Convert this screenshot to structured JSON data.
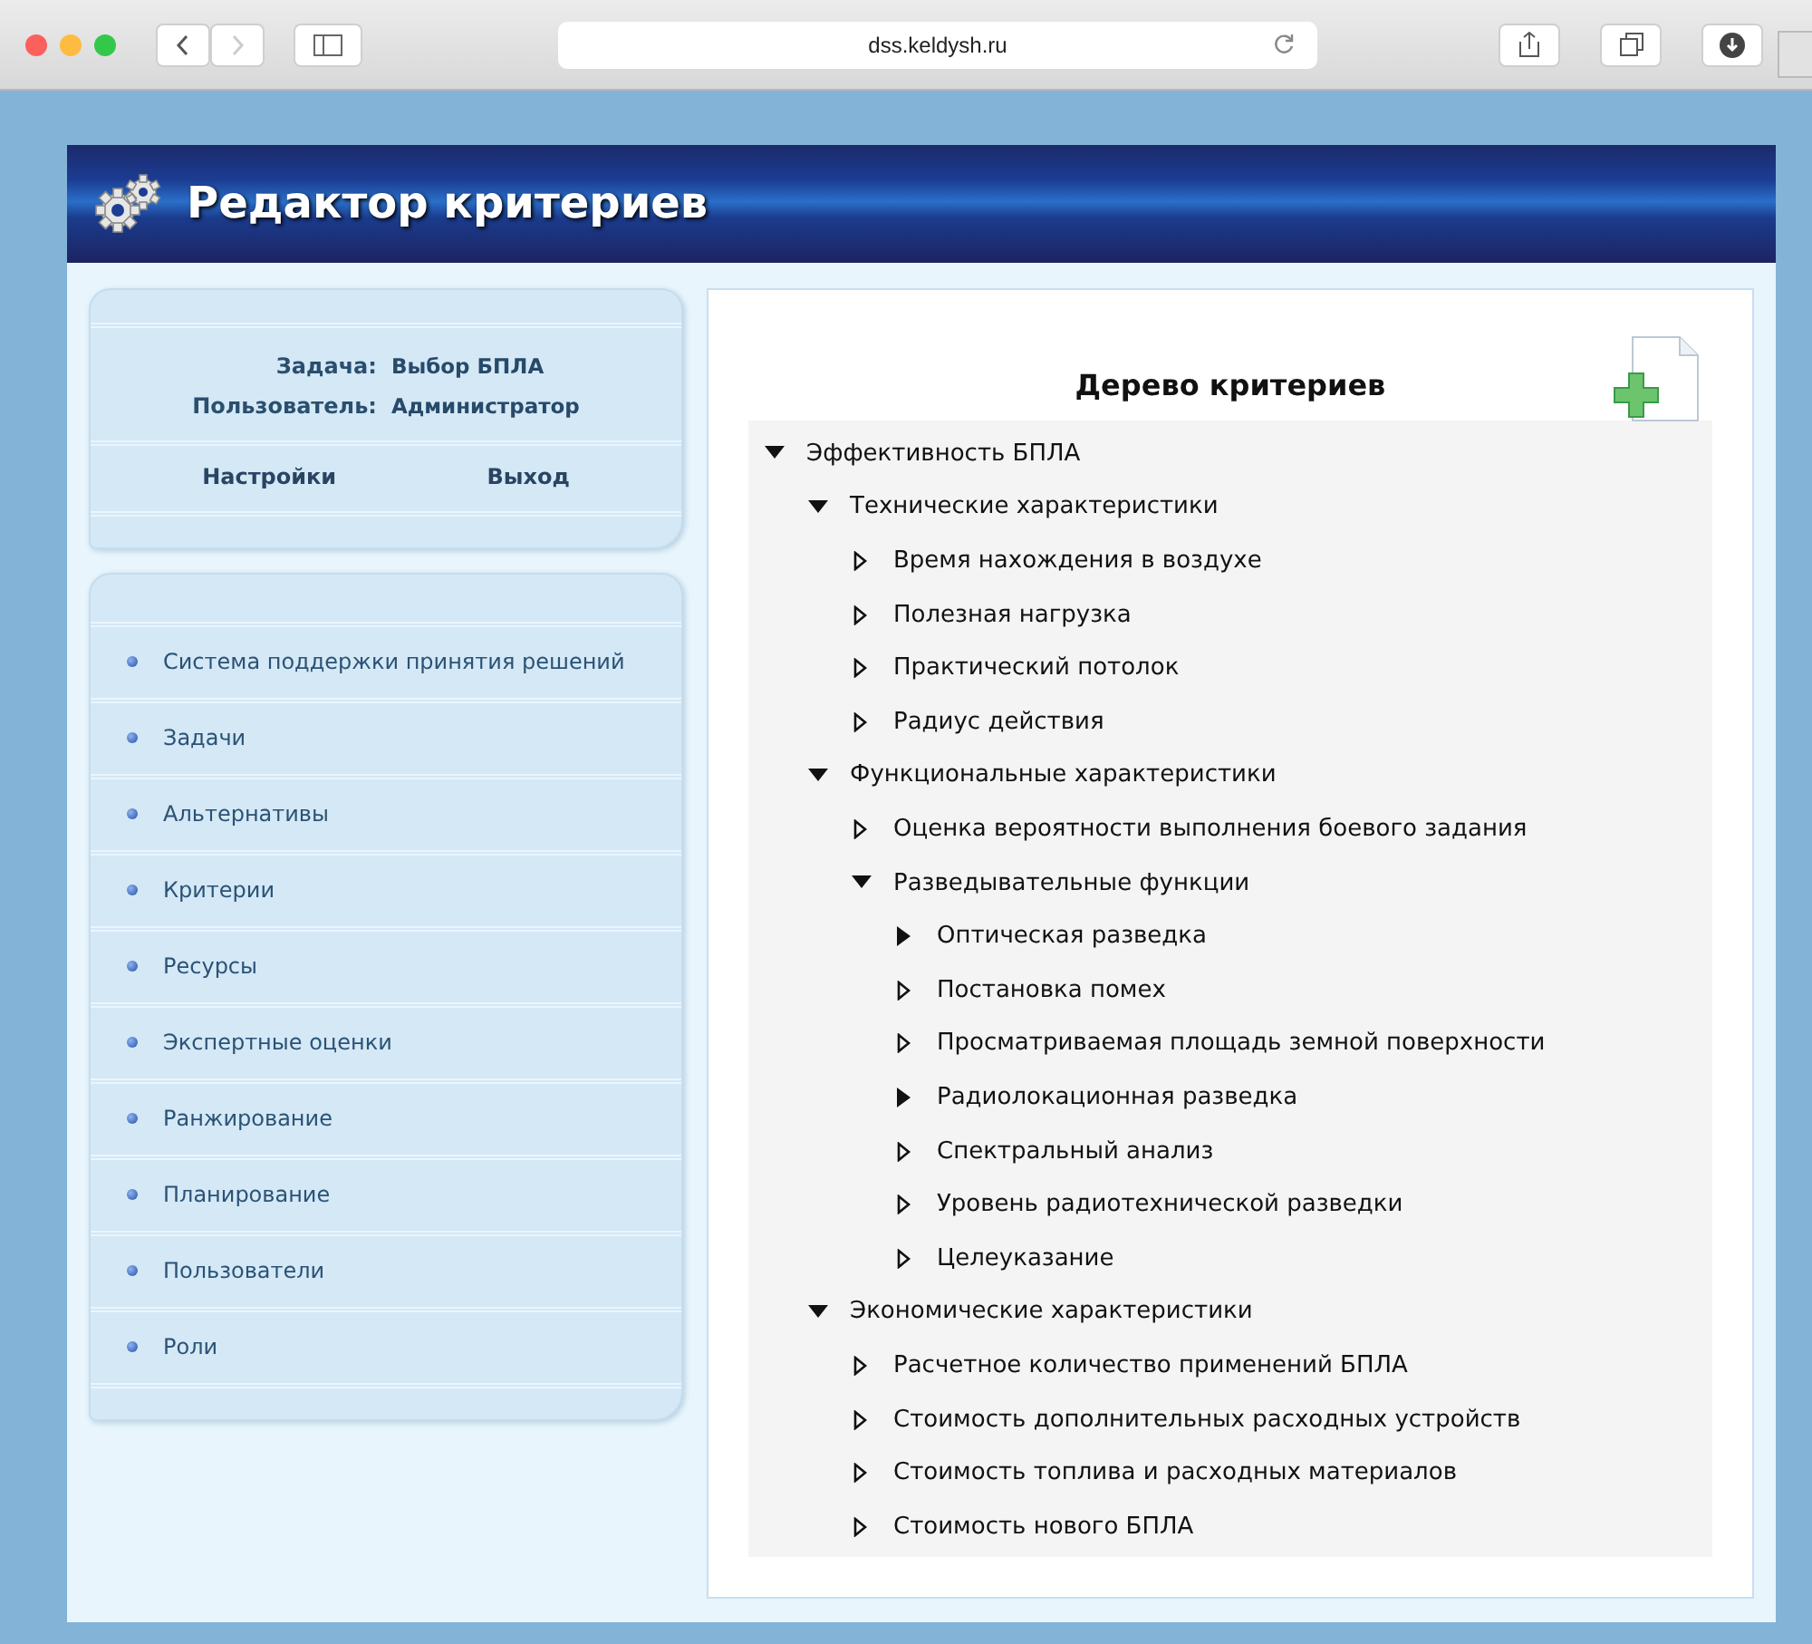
{
  "browser": {
    "address": "dss.keldysh.ru"
  },
  "header": {
    "title": "Редактор критериев"
  },
  "session": {
    "fields": [
      {
        "label": "Задача:",
        "value": "Выбор БПЛА"
      },
      {
        "label": "Пользователь:",
        "value": "Администратор"
      }
    ],
    "links": [
      "Настройки",
      "Выход"
    ]
  },
  "nav": [
    "Система поддержки принятия решений",
    "Задачи",
    "Альтернативы",
    "Критерии",
    "Ресурсы",
    "Экспертные оценки",
    "Ранжирование",
    "Планирование",
    "Пользователи",
    "Роли"
  ],
  "tree": {
    "title": "Дерево критериев",
    "nodes": [
      {
        "label": "Эффективность БПЛА",
        "kind": "branch",
        "expanded": true,
        "children": [
          {
            "label": "Технические характеристики",
            "kind": "branch",
            "expanded": true,
            "children": [
              {
                "label": "Время нахождения в воздухе",
                "kind": "leaf"
              },
              {
                "label": "Полезная нагрузка",
                "kind": "leaf"
              },
              {
                "label": "Практический потолок",
                "kind": "leaf"
              },
              {
                "label": "Радиус действия",
                "kind": "leaf"
              }
            ]
          },
          {
            "label": "Функциональные характеристики",
            "kind": "branch",
            "expanded": true,
            "children": [
              {
                "label": "Оценка вероятности выполнения боевого задания",
                "kind": "leaf"
              },
              {
                "label": "Разведывательные функции",
                "kind": "branch",
                "expanded": true,
                "children": [
                  {
                    "label": "Оптическая разведка",
                    "kind": "branch",
                    "expanded": false
                  },
                  {
                    "label": "Постановка помех",
                    "kind": "leaf"
                  },
                  {
                    "label": "Просматриваемая площадь земной поверхности",
                    "kind": "leaf"
                  },
                  {
                    "label": "Радиолокационная разведка",
                    "kind": "branch",
                    "expanded": false
                  },
                  {
                    "label": "Спектральный анализ",
                    "kind": "leaf"
                  },
                  {
                    "label": "Уровень радиотехнической разведки",
                    "kind": "leaf"
                  },
                  {
                    "label": "Целеуказание",
                    "kind": "leaf"
                  }
                ]
              }
            ]
          },
          {
            "label": "Экономические характеристики",
            "kind": "branch",
            "expanded": true,
            "children": [
              {
                "label": "Расчетное количество применений БПЛА",
                "kind": "leaf"
              },
              {
                "label": "Стоимость дополнительных расходных устройств",
                "kind": "leaf"
              },
              {
                "label": "Стоимость топлива и расходных материалов",
                "kind": "leaf"
              },
              {
                "label": "Стоимость нового БПЛА",
                "kind": "leaf"
              }
            ]
          }
        ]
      }
    ]
  }
}
